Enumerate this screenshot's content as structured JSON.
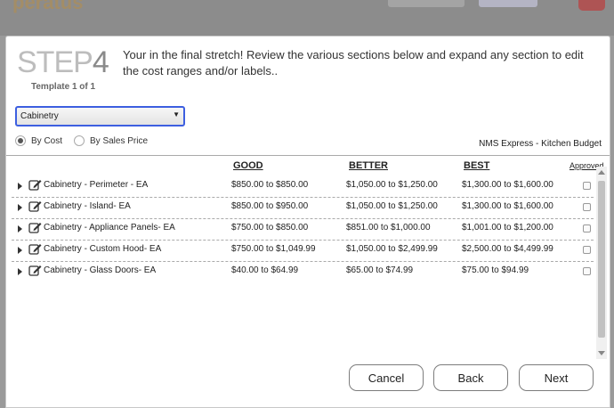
{
  "backdrop": {
    "logo_text": "peratus"
  },
  "step": {
    "word": "STEP",
    "number": "4",
    "template_label": "Template 1  of 1"
  },
  "intro_text": "Your in the final stretch!  Review the various sections below and expand any section to edit the cost ranges and/or labels..",
  "section_select": {
    "value": "Cabinetry"
  },
  "price_basis": {
    "options": [
      {
        "label": "By Cost",
        "checked": true
      },
      {
        "label": "By Sales Price",
        "checked": false
      }
    ]
  },
  "budget_name": "NMS Express - Kitchen Budget",
  "columns": {
    "good": "GOOD",
    "better": "BETTER",
    "best": "BEST",
    "approved": "Approved"
  },
  "rows": [
    {
      "label": "Cabinetry - Perimeter - EA",
      "good": "$850.00 to $850.00",
      "better": "$1,050.00 to $1,250.00",
      "best": "$1,300.00 to $1,600.00"
    },
    {
      "label": "Cabinetry - Island- EA",
      "good": "$850.00 to $950.00",
      "better": "$1,050.00 to $1,250.00",
      "best": "$1,300.00 to $1,600.00"
    },
    {
      "label": "Cabinetry - Appliance Panels- EA",
      "good": "$750.00 to $850.00",
      "better": "$851.00 to $1,000.00",
      "best": "$1,001.00 to $1,200.00"
    },
    {
      "label": "Cabinetry - Custom Hood- EA",
      "good": "$750.00 to $1,049.99",
      "better": "$1,050.00 to $2,499.99",
      "best": "$2,500.00 to $4,499.99"
    },
    {
      "label": "Cabinetry - Glass Doors- EA",
      "good": "$40.00 to $64.99",
      "better": "$65.00 to $74.99",
      "best": "$75.00 to $94.99"
    }
  ],
  "buttons": {
    "cancel": "Cancel",
    "back": "Back",
    "next": "Next"
  },
  "icons": {
    "expand": "caret-right-icon",
    "edit": "edit-icon",
    "select": "dropdown-arrow-icon"
  },
  "colors": {
    "select_border": "#3d5fe0",
    "step_word": "#bdbdbd",
    "step_number": "#8a8a8a"
  }
}
